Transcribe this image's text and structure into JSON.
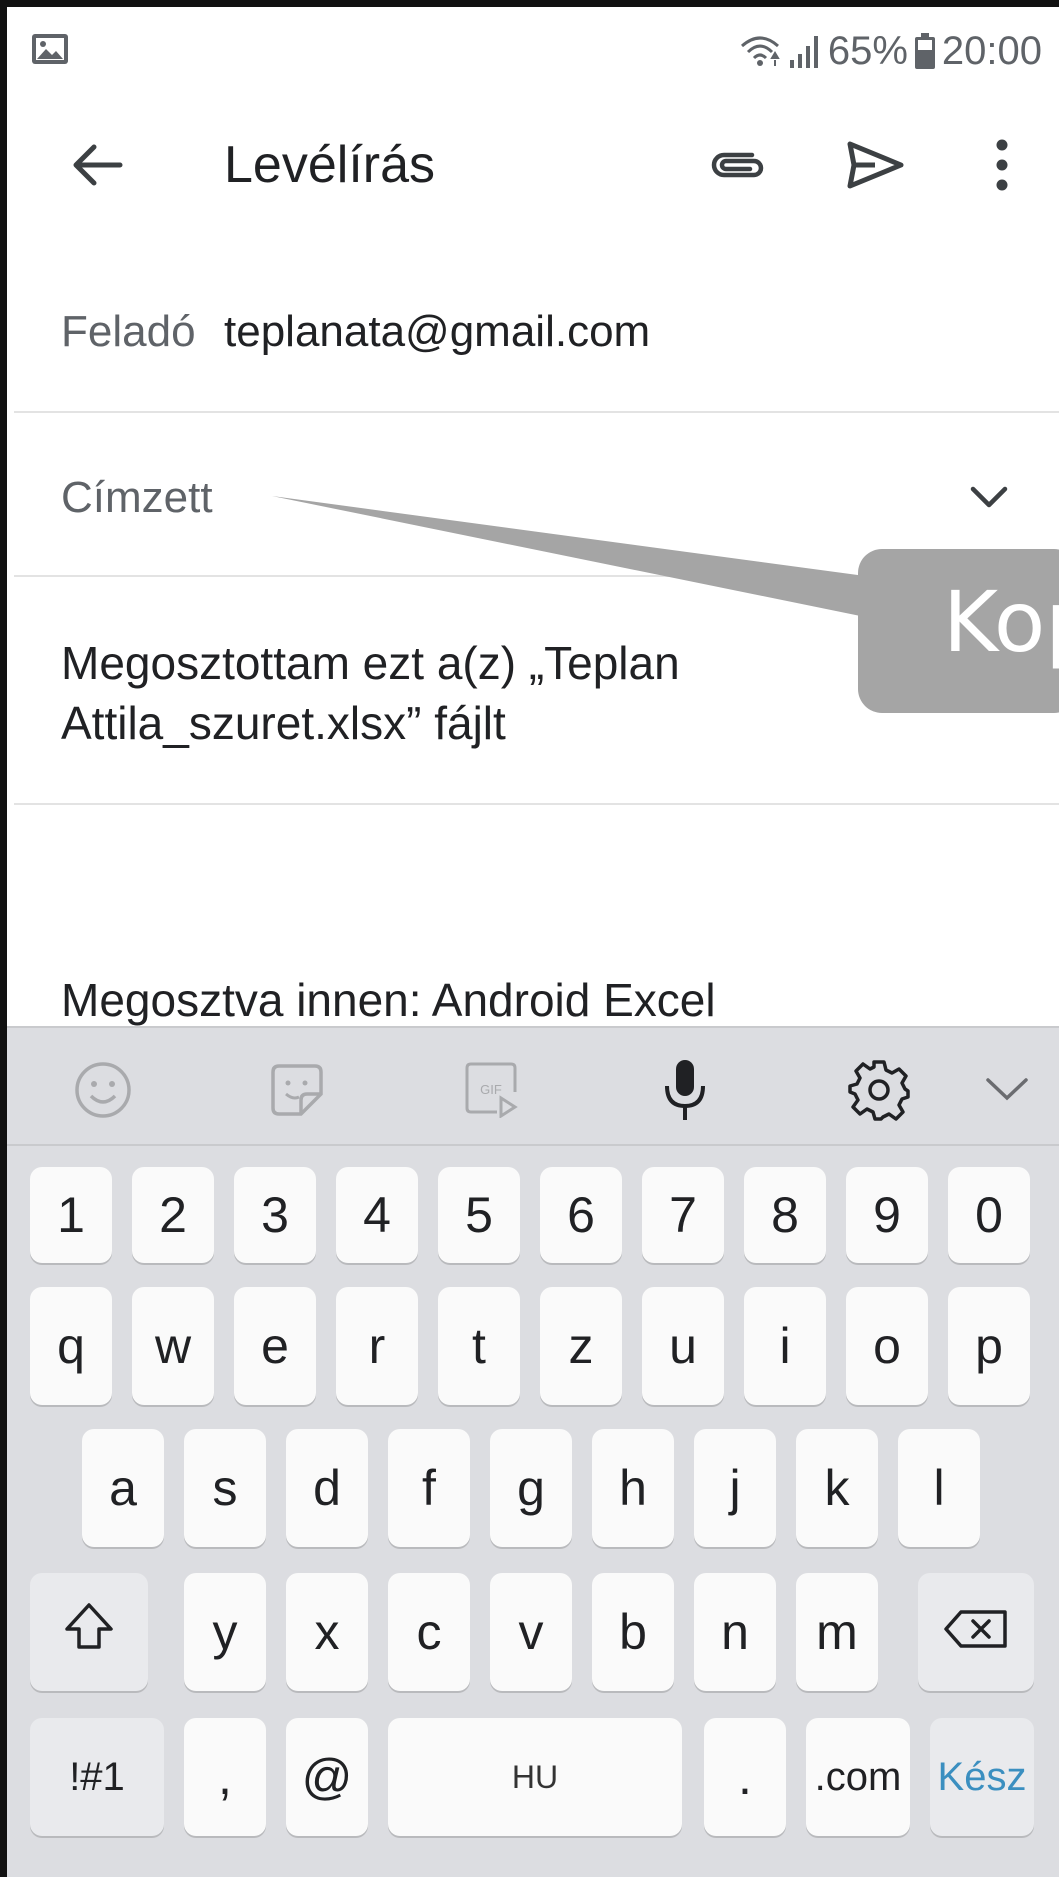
{
  "status_bar": {
    "battery": "65%",
    "time": "20:00",
    "icons": [
      "gallery-icon",
      "wifi-icon",
      "signal-icon",
      "battery-icon"
    ]
  },
  "app_bar": {
    "title": "Levélírás",
    "icons": [
      "back-arrow-icon",
      "paperclip-icon",
      "send-icon",
      "more-vert-icon"
    ]
  },
  "compose": {
    "from_label": "Feladó",
    "from_value": "teplanata@gmail.com",
    "to_label": "Címzett",
    "subject": "Megosztottam ezt a(z) „Teplan Attila_szuret.xlsx” fájlt",
    "body": "Megosztva innen: Android Excel"
  },
  "callout": {
    "text": "Kop"
  },
  "keyboard": {
    "toolbar_icons": [
      "emoji-icon",
      "sticker-icon",
      "gif-icon",
      "microphone-icon",
      "settings-icon",
      "collapse-icon"
    ],
    "gif_label": "GIF",
    "numbers": [
      "1",
      "2",
      "3",
      "4",
      "5",
      "6",
      "7",
      "8",
      "9",
      "0"
    ],
    "row1": [
      "q",
      "w",
      "e",
      "r",
      "t",
      "z",
      "u",
      "i",
      "o",
      "p"
    ],
    "row2": [
      "a",
      "s",
      "d",
      "f",
      "g",
      "h",
      "j",
      "k",
      "l"
    ],
    "row3": [
      "y",
      "x",
      "c",
      "v",
      "b",
      "n",
      "m"
    ],
    "symbols": "!#1",
    "comma": ",",
    "at": "@",
    "space": "HU",
    "period": ".",
    "dotcom": ".com",
    "done": "Kész"
  },
  "colors": {
    "accent_done": "#3b8fc0",
    "keyboard_bg": "#dcdde1",
    "callout_bg": "#a5a5a5"
  }
}
